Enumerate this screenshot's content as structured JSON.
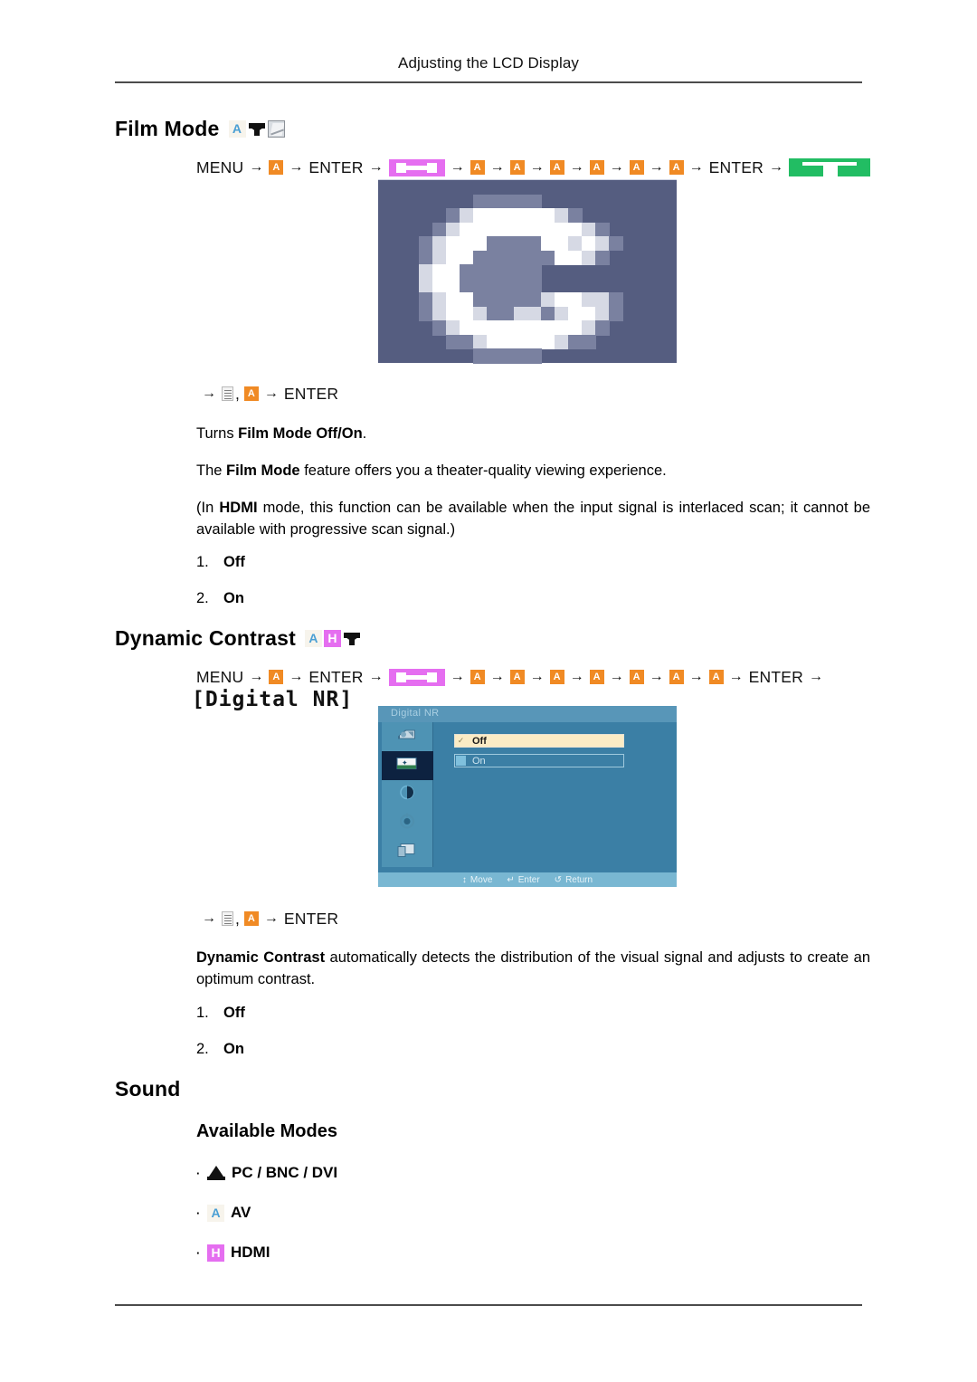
{
  "header": {
    "title": "Adjusting the LCD Display"
  },
  "sections": {
    "film_mode": {
      "heading": "Film Mode",
      "heading_icons": [
        "av-icon",
        "antenna-icon",
        "component-icon"
      ],
      "path": {
        "start": "MENU",
        "enter1": "ENTER",
        "enter2": "ENTER",
        "step_count": 6,
        "badge_label": "A"
      },
      "path2": "ENTER",
      "desc1_prefix": "Turns ",
      "desc1_bold": "Film Mode Off/On",
      "desc1_suffix": ".",
      "desc2_pre": "The ",
      "desc2_bold": "Film Mode",
      "desc2_post": " feature offers you a theater-quality viewing experience.",
      "desc3_pre": "(In ",
      "desc3_bold": "HDMI",
      "desc3_post": " mode, this function can be available when the input signal is interlaced scan; it cannot be available with progressive scan signal.)",
      "options": [
        {
          "num": "1.",
          "value": "Off"
        },
        {
          "num": "2.",
          "value": "On"
        }
      ]
    },
    "dynamic_contrast": {
      "heading": "Dynamic Contrast",
      "heading_icons": [
        "av-icon",
        "hdmi-icon",
        "antenna-icon"
      ],
      "path": {
        "start": "MENU",
        "enter1": "ENTER",
        "enter2": "ENTER",
        "step_count": 7,
        "badge_label": "A"
      },
      "bitmap_title": "[Digital NR]",
      "path2": "ENTER",
      "desc_bold": "Dynamic Contrast",
      "desc_rest": " automatically detects the distribution of the visual signal and adjusts to create an optimum contrast.",
      "options": [
        {
          "num": "1.",
          "value": "Off"
        },
        {
          "num": "2.",
          "value": "On"
        }
      ]
    },
    "sound": {
      "heading": "Sound",
      "available_modes_heading": "Available Modes",
      "modes": [
        {
          "icon": "pc-icon",
          "label": "PC / BNC / DVI"
        },
        {
          "icon": "av-icon",
          "label": "AV"
        },
        {
          "icon": "hdmi-icon",
          "label": "HDMI"
        }
      ]
    }
  },
  "osd": {
    "title": "Digital  NR",
    "sidebar_icons": [
      "picture-icon",
      "image-icon",
      "setup-icon",
      "option-icon",
      "multi-control-icon"
    ],
    "selected_sidebar_index": 1,
    "rows": [
      {
        "label": "Off",
        "selected": true
      },
      {
        "label": "On",
        "selected": false
      }
    ],
    "footer": [
      {
        "glyph": "↕",
        "label": "Move"
      },
      {
        "glyph": "↵",
        "label": "Enter"
      },
      {
        "glyph": "↺",
        "label": "Return"
      }
    ]
  },
  "colors": {
    "badge_orange": "#f08a24",
    "hdmi_magenta": "#e56ef0",
    "green": "#22bd63",
    "av_blue": "#4a9fd4",
    "osd_blue": "#3b7fa5",
    "osd_highlight": "#fbecc5",
    "pixel_navy": "#555d80"
  }
}
